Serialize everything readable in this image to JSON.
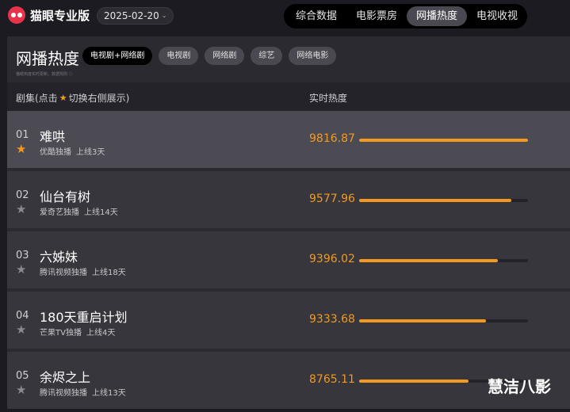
{
  "app": {
    "title": "猫眼专业版",
    "date": "2025-02-20",
    "date_chevron": "⌄",
    "brand_color": "#e8344a",
    "accent_color": "#f29a1f"
  },
  "nav": {
    "tabs": [
      {
        "label": "综合数据",
        "active": false
      },
      {
        "label": "电影票房",
        "active": false
      },
      {
        "label": "网播热度",
        "active": true
      },
      {
        "label": "电视收视",
        "active": false
      }
    ]
  },
  "panel": {
    "title": "网播热度",
    "filters": [
      {
        "label": "电视剧+网络剧",
        "active": true
      },
      {
        "label": "电视剧",
        "active": false
      },
      {
        "label": "网络剧",
        "active": false
      },
      {
        "label": "综艺",
        "active": false
      },
      {
        "label": "网络电影",
        "active": false
      }
    ],
    "note": "猫眼热度实时更新，数据规则 ⓘ"
  },
  "columns": {
    "show_prefix": "剧集(点击",
    "show_suffix": "切换右侧展示)",
    "heat": "实时热度"
  },
  "rows": [
    {
      "rank": "01",
      "name": "难哄",
      "platform": "优酷独播",
      "days": "上线3天",
      "heat": "9816.87",
      "starred": true,
      "level": 1.0
    },
    {
      "rank": "02",
      "name": "仙台有树",
      "platform": "爱奇艺独播",
      "days": "上线14天",
      "heat": "9577.96",
      "starred": false,
      "level": 0.9
    },
    {
      "rank": "03",
      "name": "六姊妹",
      "platform": "腾讯视频独播",
      "days": "上线18天",
      "heat": "9396.02",
      "starred": false,
      "level": 0.82
    },
    {
      "rank": "04",
      "name": "180天重启计划",
      "platform": "芒果TV独播",
      "days": "上线4天",
      "heat": "9333.68",
      "starred": false,
      "level": 0.75
    },
    {
      "rank": "05",
      "name": "余烬之上",
      "platform": "腾讯视频独播",
      "days": "上线13天",
      "heat": "8765.11",
      "starred": false,
      "level": 0.65
    }
  ],
  "watermark": "慧洁八影"
}
